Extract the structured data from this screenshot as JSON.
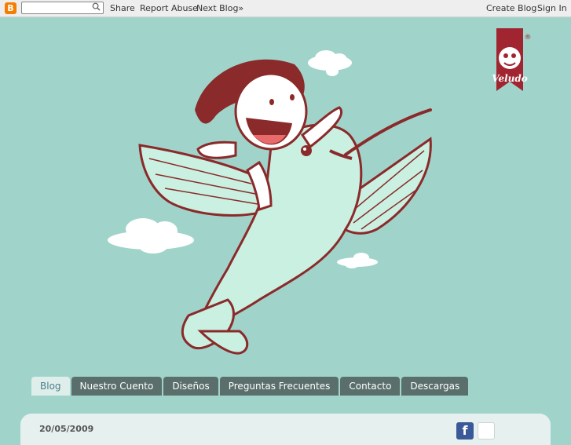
{
  "navbar": {
    "logo_letter": "B",
    "search_placeholder": "",
    "share": "Share",
    "report_abuse": "Report Abuse",
    "next_blog": "Next Blog»",
    "create_blog": "Create Blog",
    "sign_in": "Sign In"
  },
  "brand": {
    "name": "Veludo",
    "registered": "®"
  },
  "tabs": [
    {
      "label": "Blog",
      "active": true
    },
    {
      "label": "Nuestro Cuento"
    },
    {
      "label": "Diseños"
    },
    {
      "label": "Preguntas Frecuentes"
    },
    {
      "label": "Contacto"
    },
    {
      "label": "Descargas"
    }
  ],
  "post": {
    "date": "20/05/2009"
  },
  "colors": {
    "background": "#a0d4cb",
    "tab": "#5a6f6c",
    "illustration": "#8a2a2a",
    "bird": "#c9f0e0"
  }
}
